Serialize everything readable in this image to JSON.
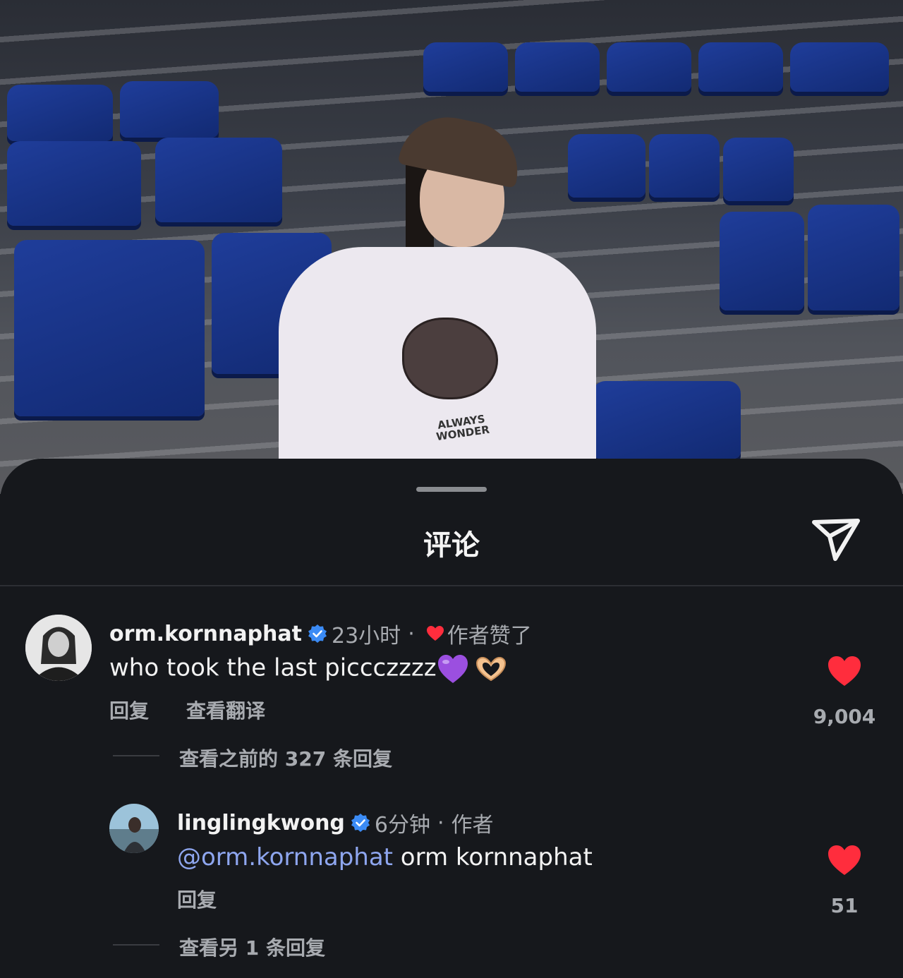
{
  "sheet": {
    "title": "评论"
  },
  "comments": [
    {
      "username": "orm.kornnaphat",
      "time": "23小时",
      "liked_by_author": "作者赞了",
      "text": "who took the last piccczzzz",
      "reply_label": "回复",
      "translate_label": "查看翻译",
      "likes": "9,004",
      "view_previous_replies": "查看之前的 327 条回复"
    },
    {
      "username": "linglingkwong",
      "time": "6分钟",
      "author_label": "作者",
      "mention": "@orm.kornnaphat",
      "text": " orm kornnaphat",
      "reply_label": "回复",
      "likes": "51",
      "view_more_replies": "查看另 1 条回复"
    }
  ],
  "photo": {
    "shirt_text": "ALWAYS WONDER"
  },
  "colors": {
    "like_red": "#ff2d3d",
    "verified_blue": "#3b8bf5",
    "mention_blue": "#8ea6ef"
  },
  "icons": [
    "send-icon",
    "verified-badge-icon",
    "heart-icon",
    "purple-heart-emoji",
    "heart-hands-emoji"
  ]
}
